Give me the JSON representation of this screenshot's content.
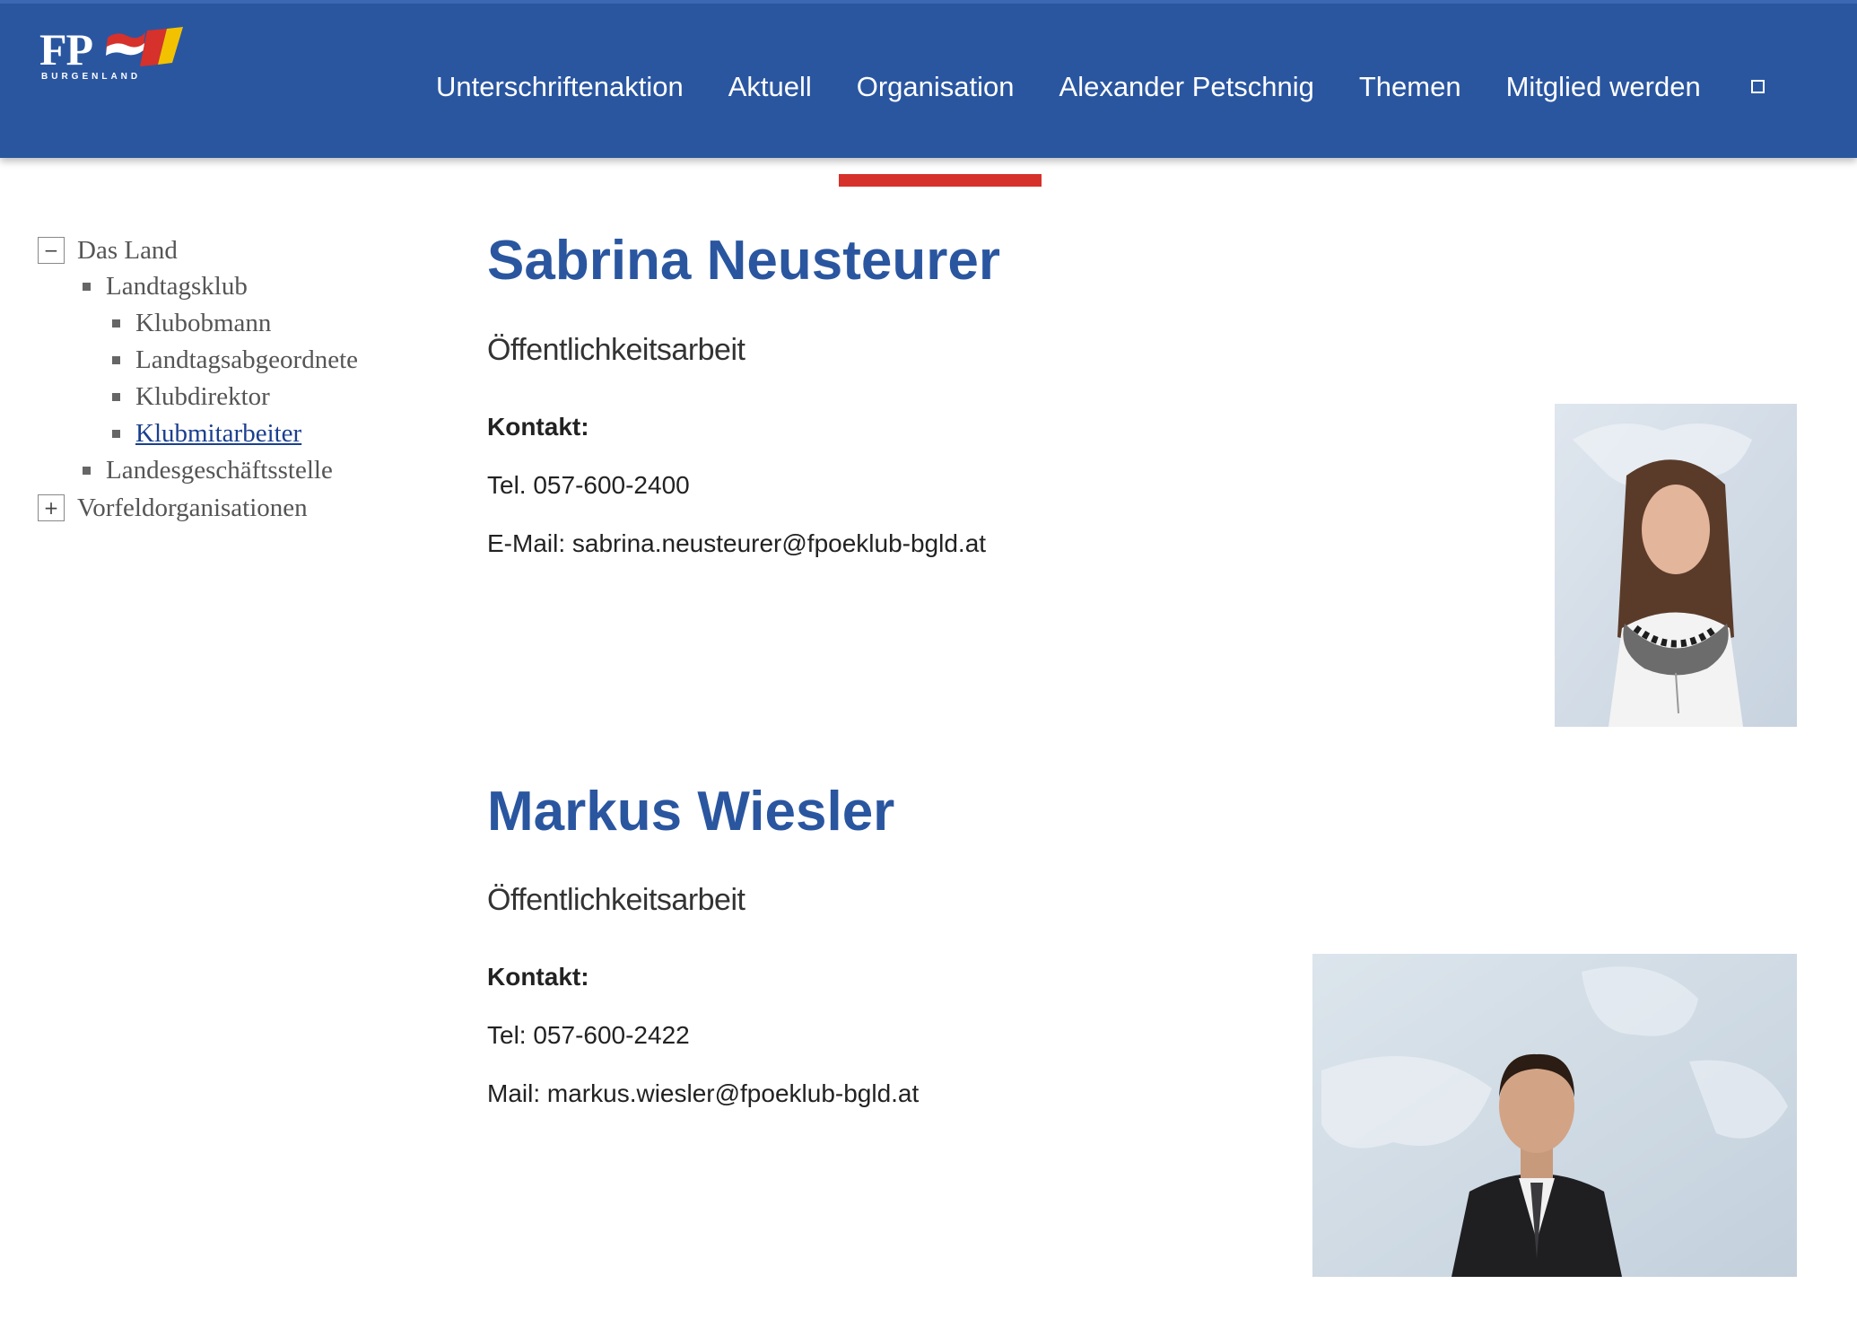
{
  "header": {
    "logo_text": "FP",
    "logo_sub": "BURGENLAND",
    "nav": [
      {
        "label": "Unterschriftenaktion"
      },
      {
        "label": "Aktuell"
      },
      {
        "label": "Organisation"
      },
      {
        "label": "Alexander Petschnig"
      },
      {
        "label": "Themen"
      },
      {
        "label": "Mitglied werden"
      }
    ],
    "active_index": 2
  },
  "sidebar": {
    "items": [
      {
        "label": "Das Land",
        "toggle": "−"
      },
      {
        "label": "Landtagsklub"
      },
      {
        "label": "Klubobmann"
      },
      {
        "label": "Landtagsabgeordnete"
      },
      {
        "label": "Klubdirektor"
      },
      {
        "label": "Klubmitarbeiter"
      },
      {
        "label": "Landesgeschäftsstelle"
      },
      {
        "label": "Vorfeldorganisationen",
        "toggle": "+"
      }
    ]
  },
  "people": [
    {
      "name": "Sabrina Neusteurer",
      "role": "Öffentlichkeitsarbeit",
      "contact_label": "Kontakt:",
      "phone": "Tel. 057-600-2400",
      "email": "E-Mail: sabrina.neusteurer@fpoeklub-bgld.at"
    },
    {
      "name": "Markus Wiesler",
      "role": "Öffentlichkeitsarbeit",
      "contact_label": "Kontakt:",
      "phone": "Tel: 057-600-2422",
      "email": "Mail: markus.wiesler@fpoeklub-bgld.at"
    }
  ],
  "colors": {
    "header_blue": "#2a56a0",
    "accent_red": "#d6312b",
    "name_blue": "#2a56a0"
  }
}
